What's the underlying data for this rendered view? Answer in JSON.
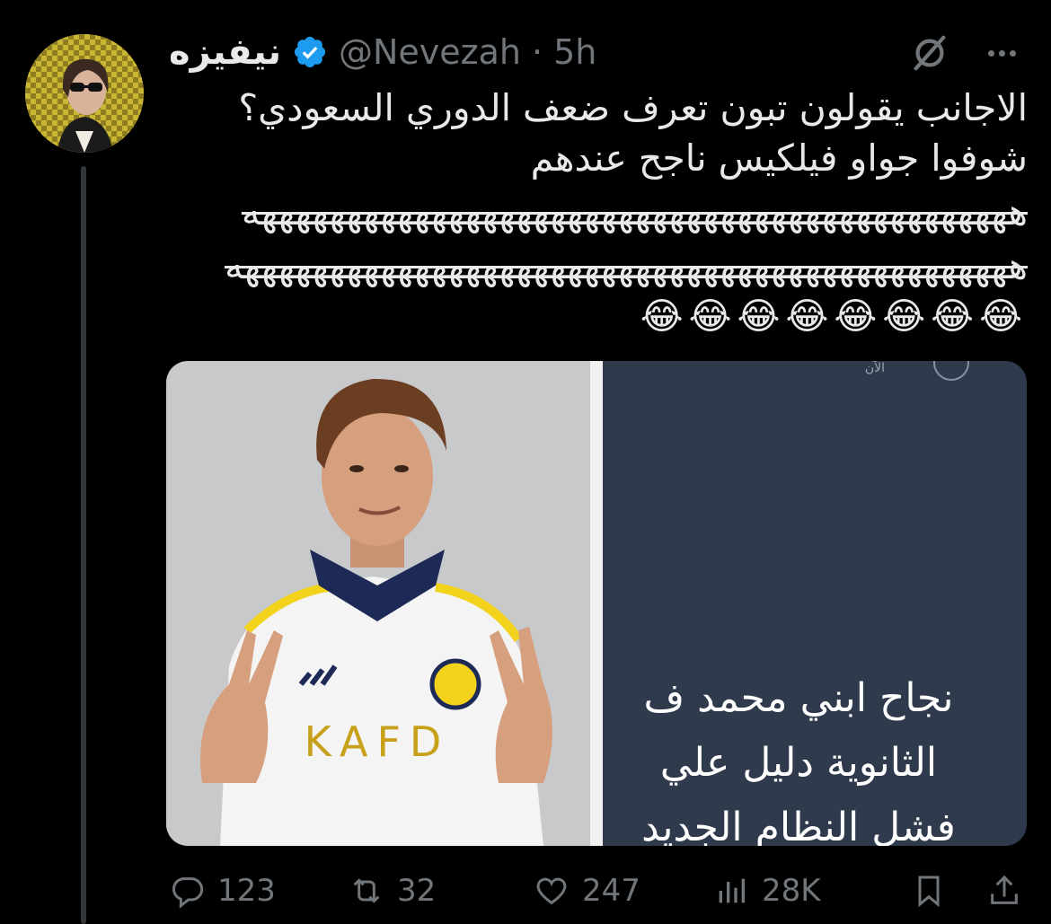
{
  "tweet": {
    "author_name": "نيفيزه",
    "handle": "@Nevezah",
    "separator": "·",
    "time": "5h",
    "lines": [
      "الاجانب يقولون تبون تعرف ضعف الدوري السعودي؟",
      "شوفوا جواو فيلكيس ناجح عندهم"
    ],
    "strike_lines": [
      "هههههههههههههههههههههههههههههههههههههههههههههه",
      "ههههههههههههههههههههههههههههههههههههههههههههههه"
    ],
    "emoji_line": "😂😂😂😂😂😂😂😂"
  },
  "media": {
    "jersey_text": "KAFD",
    "screenshot_time": "الآن",
    "screenshot_lines": [
      "نجاح ابني محمد ف",
      "الثانوية دليل علي",
      "فشل النظام الجديد"
    ]
  },
  "actions": {
    "replies": "123",
    "reposts": "32",
    "likes": "247",
    "views": "28K"
  },
  "colors": {
    "background": "#000000",
    "text_primary": "#e7e9ea",
    "text_secondary": "#71767b",
    "verified_blue": "#1d9bf0"
  }
}
